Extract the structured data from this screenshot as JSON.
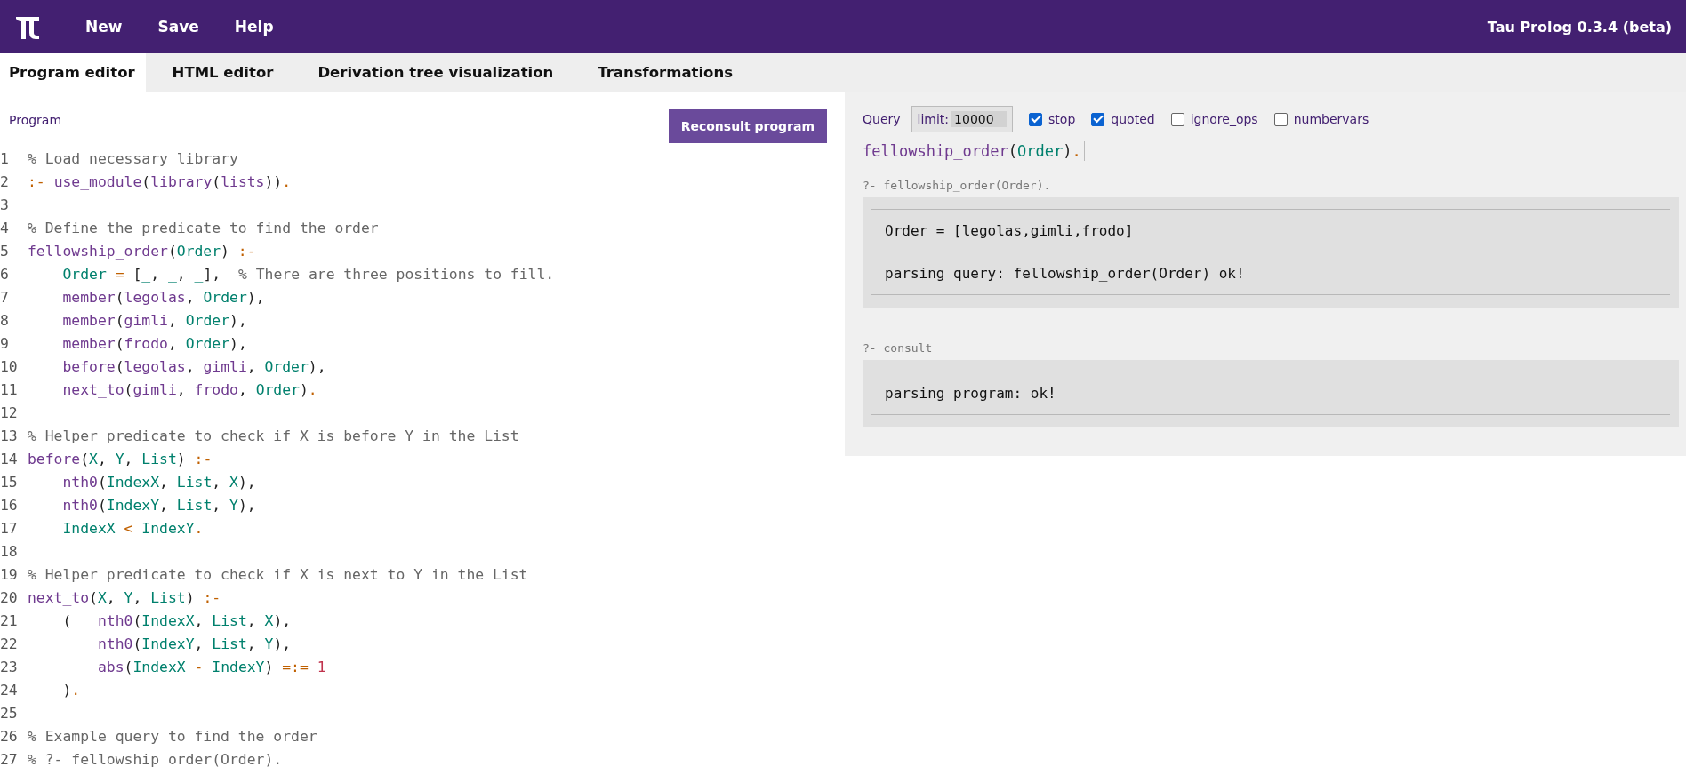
{
  "header": {
    "menu": [
      "New",
      "Save",
      "Help"
    ],
    "version": "Tau Prolog 0.3.4 (beta)"
  },
  "tabs": [
    {
      "label": "Program editor",
      "selected": true
    },
    {
      "label": "HTML editor",
      "selected": false
    },
    {
      "label": "Derivation tree visualization",
      "selected": false
    },
    {
      "label": "Transformations",
      "selected": false
    }
  ],
  "program": {
    "label": "Program",
    "button": "Reconsult program",
    "lines": [
      {
        "number": "1",
        "code": "% Load necessary library"
      },
      {
        "number": "2",
        "code": ":- use_module(library(lists))."
      },
      {
        "number": "3"
      },
      {
        "number": "4",
        "code": "% Define the predicate to find the order"
      },
      {
        "number": "5",
        "code": "fellowship_order(Order) :-"
      },
      {
        "number": "6",
        "code": "    Order = [_, _, _],  % There are three positions to fill."
      },
      {
        "number": "7",
        "code": "    member(legolas, Order),"
      },
      {
        "number": "8",
        "code": "    member(gimli, Order),"
      },
      {
        "number": "9",
        "code": "    member(frodo, Order),"
      },
      {
        "number": "10",
        "code": "    before(legolas, gimli, Order),"
      },
      {
        "number": "11",
        "code": "    next_to(gimli, frodo, Order)."
      },
      {
        "number": "12"
      },
      {
        "number": "13",
        "code": "% Helper predicate to check if X is before Y in the List"
      },
      {
        "number": "14",
        "code": "before(X, Y, List) :-"
      },
      {
        "number": "15",
        "code": "    nth0(IndexX, List, X),"
      },
      {
        "number": "16",
        "code": "    nth0(IndexY, List, Y),"
      },
      {
        "number": "17",
        "code": "    IndexX < IndexY."
      },
      {
        "number": "18"
      },
      {
        "number": "19",
        "code": "% Helper predicate to check if X is next to Y in the List"
      },
      {
        "number": "20",
        "code": "next_to(X, Y, List) :-"
      },
      {
        "number": "21",
        "code": "    (   nth0(IndexX, List, X),"
      },
      {
        "number": "22",
        "code": "        nth0(IndexY, List, Y),"
      },
      {
        "number": "23",
        "code": "        abs(IndexX - IndexY) =:= 1"
      },
      {
        "number": "24",
        "code": "    )."
      },
      {
        "number": "25"
      },
      {
        "number": "26",
        "code": "% Example query to find the order"
      },
      {
        "number": "27",
        "code": "% ?- fellowship_order(Order)."
      }
    ]
  },
  "query": {
    "label": "Query",
    "limit_label": "limit:",
    "limit_value": "10000",
    "options": [
      {
        "label": "stop",
        "checked": true
      },
      {
        "label": "quoted",
        "checked": true
      },
      {
        "label": "ignore_ops",
        "checked": false
      },
      {
        "label": "numbervars",
        "checked": false
      }
    ],
    "input": "fellowship_order(Order).",
    "results": [
      {
        "title": "?- fellowship_order(Order).",
        "lines": [
          "Order = [legolas,gimli,frodo]",
          "parsing query: fellowship_order(Order) ok!"
        ]
      },
      {
        "title": "?- consult",
        "lines": [
          "parsing program: ok!"
        ]
      }
    ]
  }
}
